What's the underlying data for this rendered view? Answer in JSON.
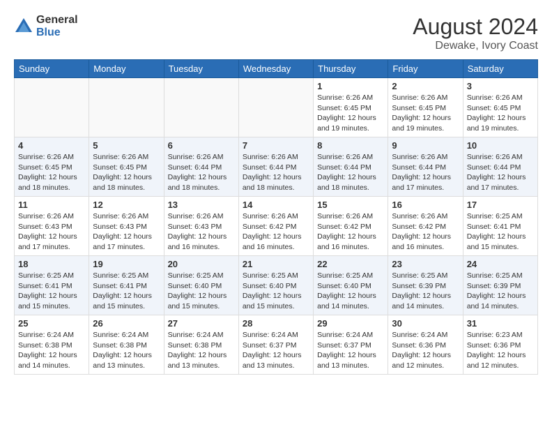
{
  "header": {
    "logo_general": "General",
    "logo_blue": "Blue",
    "month_year": "August 2024",
    "location": "Dewake, Ivory Coast"
  },
  "days_of_week": [
    "Sunday",
    "Monday",
    "Tuesday",
    "Wednesday",
    "Thursday",
    "Friday",
    "Saturday"
  ],
  "weeks": [
    [
      {
        "day": "",
        "info": ""
      },
      {
        "day": "",
        "info": ""
      },
      {
        "day": "",
        "info": ""
      },
      {
        "day": "",
        "info": ""
      },
      {
        "day": "1",
        "info": "Sunrise: 6:26 AM\nSunset: 6:45 PM\nDaylight: 12 hours\nand 19 minutes."
      },
      {
        "day": "2",
        "info": "Sunrise: 6:26 AM\nSunset: 6:45 PM\nDaylight: 12 hours\nand 19 minutes."
      },
      {
        "day": "3",
        "info": "Sunrise: 6:26 AM\nSunset: 6:45 PM\nDaylight: 12 hours\nand 19 minutes."
      }
    ],
    [
      {
        "day": "4",
        "info": "Sunrise: 6:26 AM\nSunset: 6:45 PM\nDaylight: 12 hours\nand 18 minutes."
      },
      {
        "day": "5",
        "info": "Sunrise: 6:26 AM\nSunset: 6:45 PM\nDaylight: 12 hours\nand 18 minutes."
      },
      {
        "day": "6",
        "info": "Sunrise: 6:26 AM\nSunset: 6:44 PM\nDaylight: 12 hours\nand 18 minutes."
      },
      {
        "day": "7",
        "info": "Sunrise: 6:26 AM\nSunset: 6:44 PM\nDaylight: 12 hours\nand 18 minutes."
      },
      {
        "day": "8",
        "info": "Sunrise: 6:26 AM\nSunset: 6:44 PM\nDaylight: 12 hours\nand 18 minutes."
      },
      {
        "day": "9",
        "info": "Sunrise: 6:26 AM\nSunset: 6:44 PM\nDaylight: 12 hours\nand 17 minutes."
      },
      {
        "day": "10",
        "info": "Sunrise: 6:26 AM\nSunset: 6:44 PM\nDaylight: 12 hours\nand 17 minutes."
      }
    ],
    [
      {
        "day": "11",
        "info": "Sunrise: 6:26 AM\nSunset: 6:43 PM\nDaylight: 12 hours\nand 17 minutes."
      },
      {
        "day": "12",
        "info": "Sunrise: 6:26 AM\nSunset: 6:43 PM\nDaylight: 12 hours\nand 17 minutes."
      },
      {
        "day": "13",
        "info": "Sunrise: 6:26 AM\nSunset: 6:43 PM\nDaylight: 12 hours\nand 16 minutes."
      },
      {
        "day": "14",
        "info": "Sunrise: 6:26 AM\nSunset: 6:42 PM\nDaylight: 12 hours\nand 16 minutes."
      },
      {
        "day": "15",
        "info": "Sunrise: 6:26 AM\nSunset: 6:42 PM\nDaylight: 12 hours\nand 16 minutes."
      },
      {
        "day": "16",
        "info": "Sunrise: 6:26 AM\nSunset: 6:42 PM\nDaylight: 12 hours\nand 16 minutes."
      },
      {
        "day": "17",
        "info": "Sunrise: 6:25 AM\nSunset: 6:41 PM\nDaylight: 12 hours\nand 15 minutes."
      }
    ],
    [
      {
        "day": "18",
        "info": "Sunrise: 6:25 AM\nSunset: 6:41 PM\nDaylight: 12 hours\nand 15 minutes."
      },
      {
        "day": "19",
        "info": "Sunrise: 6:25 AM\nSunset: 6:41 PM\nDaylight: 12 hours\nand 15 minutes."
      },
      {
        "day": "20",
        "info": "Sunrise: 6:25 AM\nSunset: 6:40 PM\nDaylight: 12 hours\nand 15 minutes."
      },
      {
        "day": "21",
        "info": "Sunrise: 6:25 AM\nSunset: 6:40 PM\nDaylight: 12 hours\nand 15 minutes."
      },
      {
        "day": "22",
        "info": "Sunrise: 6:25 AM\nSunset: 6:40 PM\nDaylight: 12 hours\nand 14 minutes."
      },
      {
        "day": "23",
        "info": "Sunrise: 6:25 AM\nSunset: 6:39 PM\nDaylight: 12 hours\nand 14 minutes."
      },
      {
        "day": "24",
        "info": "Sunrise: 6:25 AM\nSunset: 6:39 PM\nDaylight: 12 hours\nand 14 minutes."
      }
    ],
    [
      {
        "day": "25",
        "info": "Sunrise: 6:24 AM\nSunset: 6:38 PM\nDaylight: 12 hours\nand 14 minutes."
      },
      {
        "day": "26",
        "info": "Sunrise: 6:24 AM\nSunset: 6:38 PM\nDaylight: 12 hours\nand 13 minutes."
      },
      {
        "day": "27",
        "info": "Sunrise: 6:24 AM\nSunset: 6:38 PM\nDaylight: 12 hours\nand 13 minutes."
      },
      {
        "day": "28",
        "info": "Sunrise: 6:24 AM\nSunset: 6:37 PM\nDaylight: 12 hours\nand 13 minutes."
      },
      {
        "day": "29",
        "info": "Sunrise: 6:24 AM\nSunset: 6:37 PM\nDaylight: 12 hours\nand 13 minutes."
      },
      {
        "day": "30",
        "info": "Sunrise: 6:24 AM\nSunset: 6:36 PM\nDaylight: 12 hours\nand 12 minutes."
      },
      {
        "day": "31",
        "info": "Sunrise: 6:23 AM\nSunset: 6:36 PM\nDaylight: 12 hours\nand 12 minutes."
      }
    ]
  ]
}
